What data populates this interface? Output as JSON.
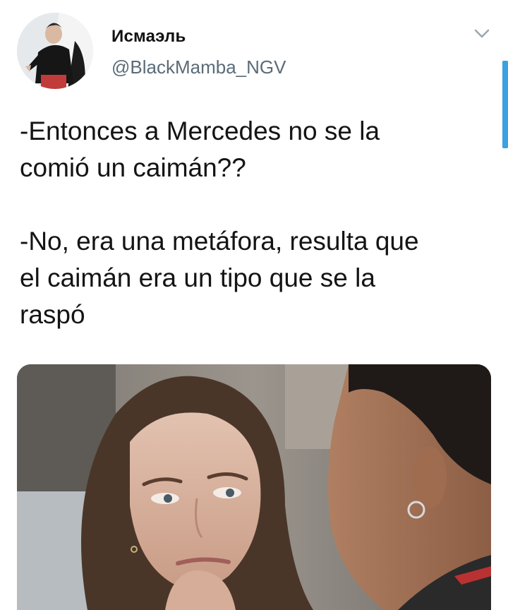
{
  "tweet": {
    "author": {
      "display_name": "Исмаэль",
      "handle": "@BlackMamba_NGV",
      "avatar_icon": "user-avatar"
    },
    "menu_icon": "chevron-down-icon",
    "text": {
      "paragraph_1": "-Entonces a Mercedes no se la\ncomió un caimán??",
      "paragraph_2": "-No, era una metáfora, resulta que\nel caimán era un tipo que se la\nraspó"
    },
    "media": {
      "type": "photo"
    }
  },
  "colors": {
    "handle": "#5b6b78",
    "scroll_indicator": "#3aa2e0"
  }
}
